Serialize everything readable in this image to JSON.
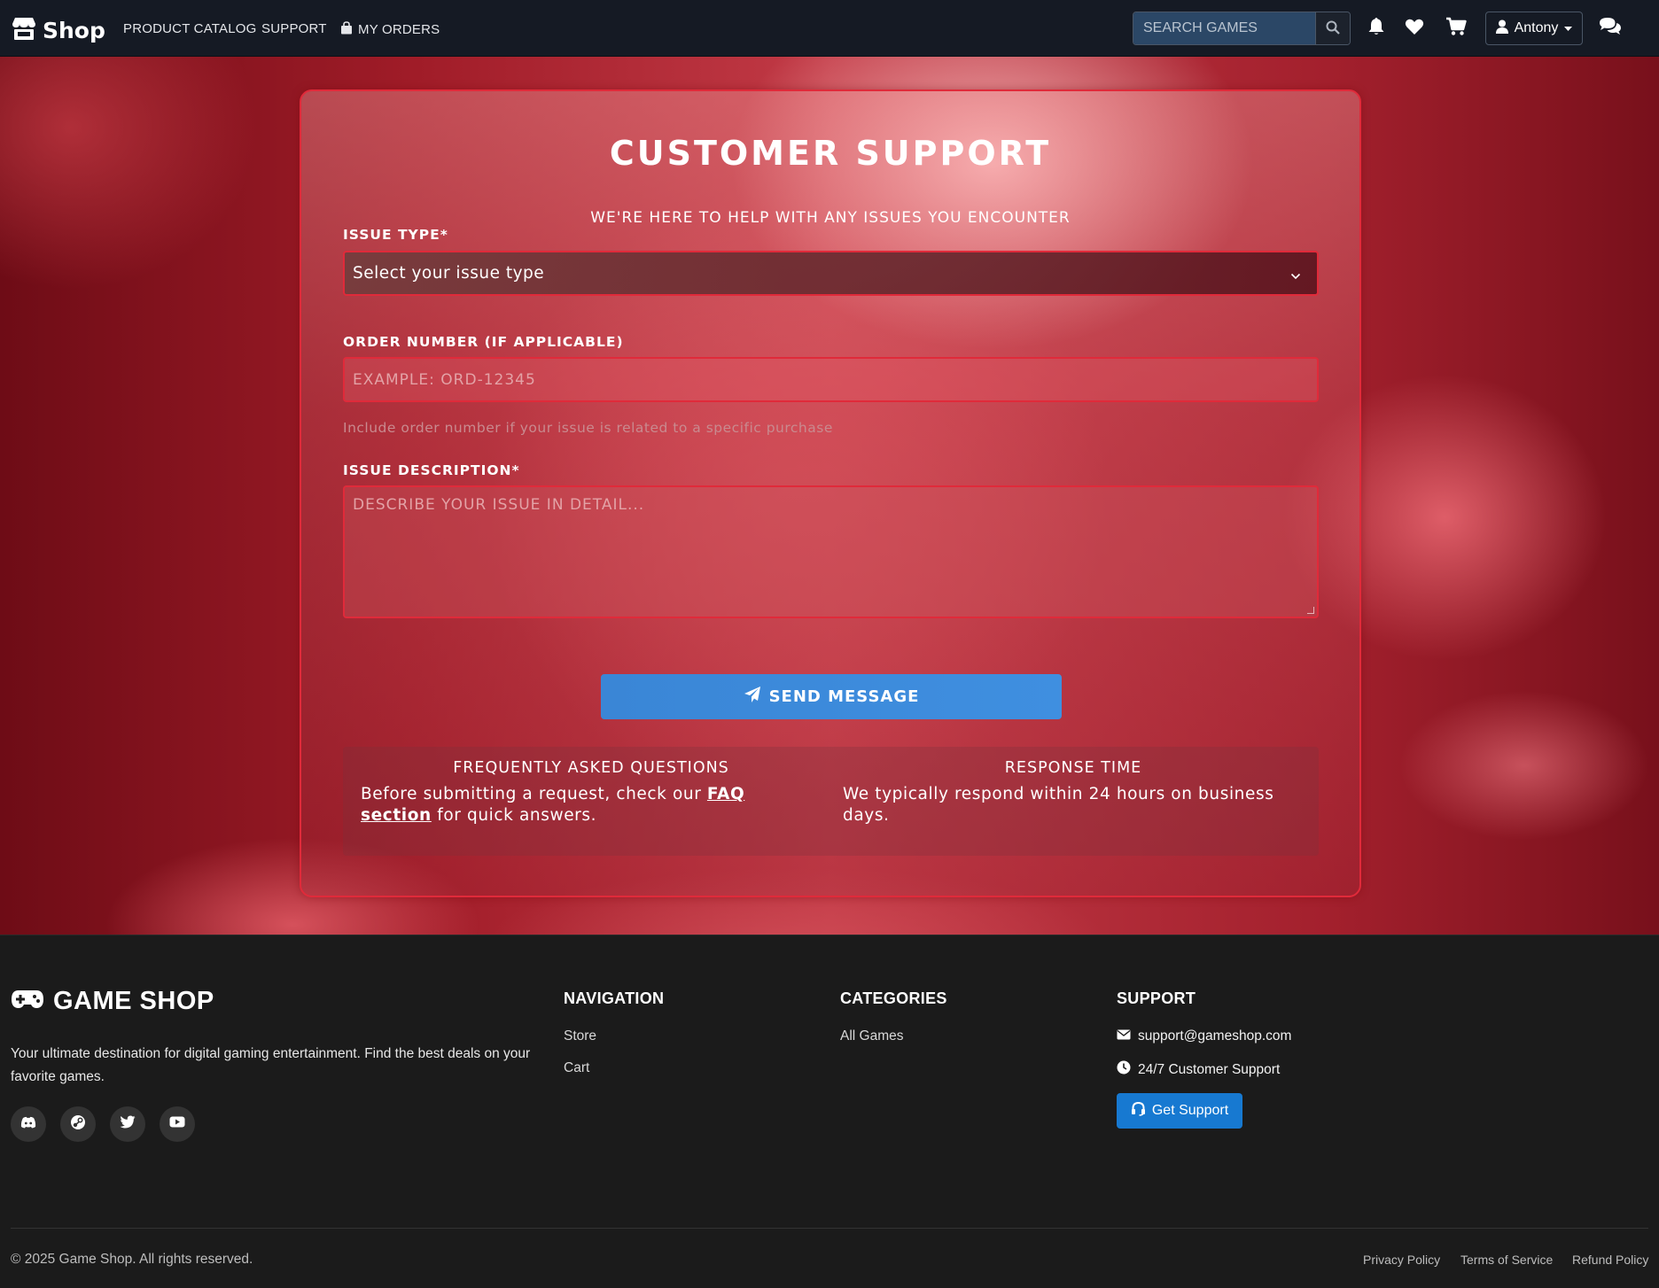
{
  "navbar": {
    "brand": "Shop",
    "links": [
      "PRODUCT CATALOG",
      "SUPPORT",
      "MY ORDERS"
    ],
    "search_placeholder": "SEARCH GAMES",
    "user_name": "Antony"
  },
  "support_form": {
    "title": "CUSTOMER SUPPORT",
    "subtitle": "WE'RE HERE TO HELP WITH ANY ISSUES YOU ENCOUNTER",
    "issue_type_label": "ISSUE TYPE*",
    "issue_type_value": "Select your issue type",
    "order_label": "ORDER NUMBER (IF APPLICABLE)",
    "order_placeholder": "EXAMPLE: ORD-12345",
    "order_help": "Include order number if your issue is related to a specific purchase",
    "description_label": "ISSUE DESCRIPTION*",
    "description_placeholder": "DESCRIBE YOUR ISSUE IN DETAIL...",
    "send_label": "SEND MESSAGE",
    "faq_heading": "FREQUENTLY ASKED QUESTIONS",
    "faq_text_before": "Before submitting a request, check our ",
    "faq_link": "FAQ section",
    "faq_text_after": " for quick answers.",
    "response_heading": "RESPONSE TIME",
    "response_text": "We typically respond within 24 hours on business days."
  },
  "footer": {
    "brand": "GAME SHOP",
    "description": "Your ultimate destination for digital gaming entertainment. Find the best deals on your favorite games.",
    "navigation_heading": "NAVIGATION",
    "navigation_links": [
      "Store",
      "Cart"
    ],
    "categories_heading": "CATEGORIES",
    "categories_links": [
      "All Games"
    ],
    "support_heading": "SUPPORT",
    "support_email": "support@gameshop.com",
    "support_hours": "24/7 Customer Support",
    "support_button": "Get Support",
    "copyright": "© 2025 Game Shop. All rights reserved.",
    "legal_links": [
      "Privacy Policy",
      "Terms of Service",
      "Refund Policy"
    ]
  },
  "colors": {
    "accent_red": "#e02a3a",
    "button_blue": "#3a86d6",
    "footer_bg": "#1b1b1b",
    "navbar_bg": "#151a24"
  },
  "icons": [
    "store-icon",
    "bag-icon",
    "search-icon",
    "bell-icon",
    "heart-icon",
    "cart-icon",
    "user-icon",
    "caret-down-icon",
    "comments-icon",
    "chevron-down-icon",
    "paper-plane-icon",
    "gamepad-icon",
    "discord-icon",
    "steam-icon",
    "twitter-icon",
    "youtube-icon",
    "envelope-icon",
    "clock-icon",
    "headset-icon"
  ]
}
